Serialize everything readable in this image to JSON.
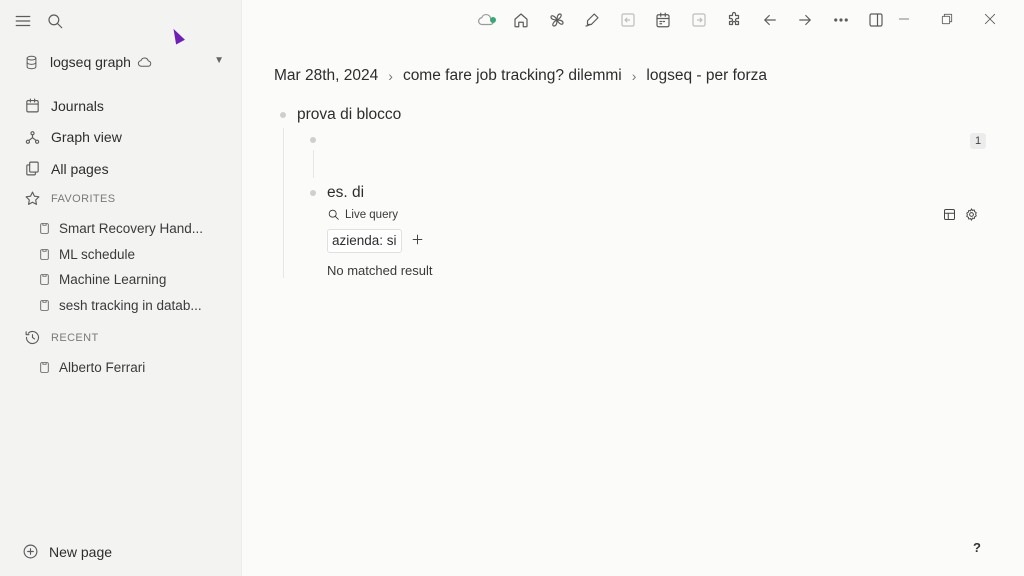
{
  "sidebar": {
    "graph_name": "logseq graph",
    "nav": [
      {
        "label": "Journals",
        "icon": "calendar-icon"
      },
      {
        "label": "Graph view",
        "icon": "graph-icon"
      },
      {
        "label": "All pages",
        "icon": "pages-icon"
      }
    ],
    "favorites_heading": "FAVORITES",
    "favorites": [
      {
        "label": "Smart Recovery Hand..."
      },
      {
        "label": "ML schedule"
      },
      {
        "label": "Machine Learning"
      },
      {
        "label": "sesh tracking in datab..."
      }
    ],
    "recent_heading": "RECENT",
    "recent": [
      {
        "label": "Alberto Ferrari"
      }
    ],
    "new_page_label": "New page"
  },
  "breadcrumb": [
    "Mar 28th, 2024",
    "come fare job tracking? dilemmi",
    "logseq - per forza"
  ],
  "blocks": {
    "root_text": "prova di blocco",
    "child_text": "es. di",
    "ref_count": "1",
    "live_query_label": "Live query",
    "query_filter": "azienda: si",
    "no_result": "No matched result"
  },
  "help_label": "?",
  "colors": {
    "sync_dot": "#3aa876",
    "cursor": "#6f1fb8",
    "sidebar_bg": "#f3f3f2",
    "main_bg": "#fbfbfa"
  }
}
